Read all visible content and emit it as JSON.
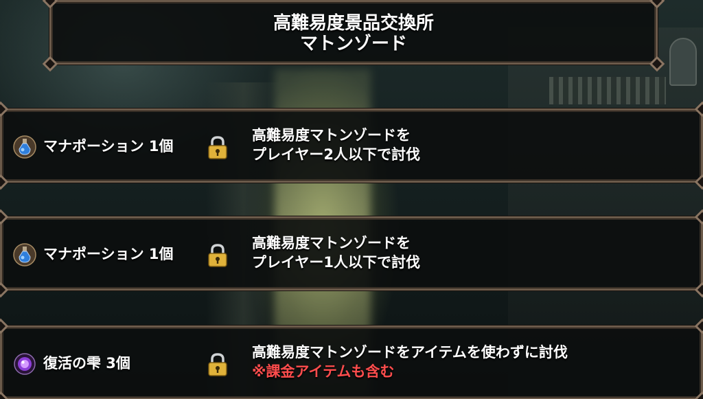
{
  "header": {
    "title_line1": "高難易度景品交換所",
    "title_line2": "マトンゾード"
  },
  "rewards": [
    {
      "icon": "mana-potion-icon",
      "name": "マナポーション 1個",
      "locked": true,
      "condition_line1": "高難易度マトンゾードを",
      "condition_line2": "プレイヤー2人以下で討伐"
    },
    {
      "icon": "mana-potion-icon",
      "name": "マナポーション 1個",
      "locked": true,
      "condition_line1": "高難易度マトンゾードを",
      "condition_line2": "プレイヤー1人以下で討伐"
    },
    {
      "icon": "revival-drop-icon",
      "name": "復活の雫 3個",
      "locked": true,
      "condition_line1": "高難易度マトンゾードをアイテムを使わずに討伐",
      "condition_note": "※課金アイテムも含む"
    }
  ],
  "colors": {
    "frame": "#6b5a4a",
    "note_text": "#ff4d4d",
    "lock_gold": "#e0b23a"
  }
}
